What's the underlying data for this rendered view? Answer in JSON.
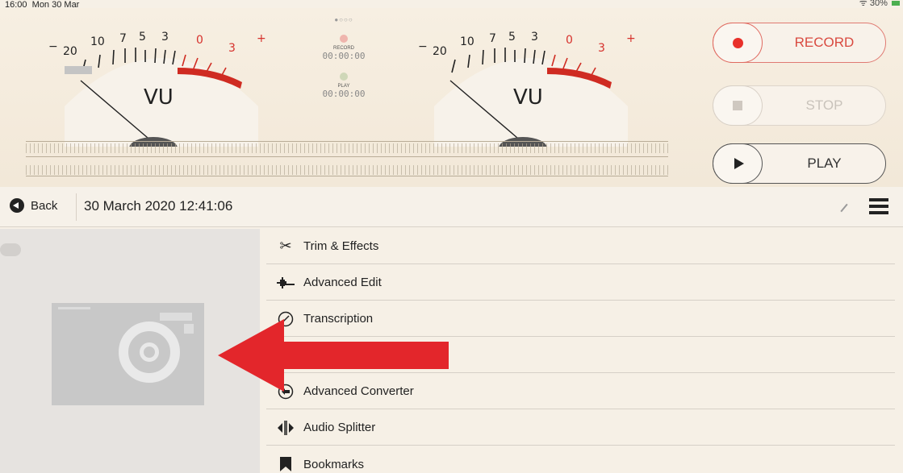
{
  "status_bar": {
    "time": "16:00",
    "date": "Mon 30 Mar",
    "battery": "30%"
  },
  "meter_left": {
    "label": "VU",
    "ticks": [
      "−",
      "20",
      "10",
      "7",
      "5",
      "3",
      "0",
      "3",
      "+"
    ]
  },
  "meter_right": {
    "label": "VU",
    "ticks": [
      "−",
      "20",
      "10",
      "7",
      "5",
      "3",
      "0",
      "3",
      "+"
    ]
  },
  "indicators": {
    "page_dots": "●○○○",
    "record_label": "RECORD",
    "record_time": "00:00:00",
    "play_label": "PLAY",
    "play_time": "00:00:00"
  },
  "controls": {
    "record": "RECORD",
    "stop": "STOP",
    "play": "PLAY"
  },
  "nav": {
    "back": "Back",
    "title": "30 March 2020 12:41:06"
  },
  "menu": {
    "items": [
      {
        "label": "Trim & Effects",
        "icon": "scissors-icon"
      },
      {
        "label": "Advanced Edit",
        "icon": "waveform-icon"
      },
      {
        "label": "Transcription",
        "icon": "pencil-circle-icon"
      },
      {
        "label": "",
        "icon": "circle-icon"
      },
      {
        "label": "Advanced Converter",
        "icon": "converter-icon"
      },
      {
        "label": "Audio Splitter",
        "icon": "splitter-icon"
      },
      {
        "label": "Bookmarks",
        "icon": "bookmark-icon"
      }
    ]
  },
  "colors": {
    "accent_red": "#e8302a",
    "arrow_red": "#e3262b",
    "background": "#f6f0e6"
  }
}
